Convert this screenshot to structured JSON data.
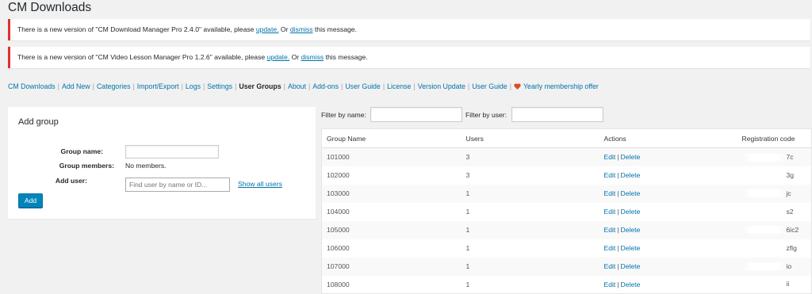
{
  "page": {
    "title": "CM Downloads"
  },
  "notices": [
    {
      "prefix": "There is a new version of \"CM Download Manager Pro 2.4.0\" available, please ",
      "update_link": "update.",
      "middle": " Or ",
      "dismiss_link": "dismiss",
      "suffix": " this message."
    },
    {
      "prefix": "There is a new version of \"CM Video Lesson Manager Pro 1.2.6\" available, please ",
      "update_link": "update.",
      "middle": " Or ",
      "dismiss_link": "dismiss",
      "suffix": " this message."
    }
  ],
  "subnav": {
    "items": [
      "CM Downloads",
      "Add New",
      "Categories",
      "Import/Export",
      "Logs",
      "Settings",
      "User Groups",
      "About",
      "Add-ons",
      "User Guide",
      "License",
      "Version Update",
      "User Guide",
      "Yearly membership offer"
    ],
    "separator": "|",
    "current": "User Groups",
    "heart_color": "#d54e21"
  },
  "add_group": {
    "title": "Add group",
    "group_name_label": "Group name:",
    "group_members_label": "Group members:",
    "group_members_value": "No members.",
    "add_user_label": "Add user:",
    "add_user_placeholder": "Find user by name or ID...",
    "show_all_users": "Show all users",
    "add_button": "Add"
  },
  "filters": {
    "by_name_label": "Filter by name:",
    "by_user_label": "Filter by user:"
  },
  "table": {
    "headers": [
      "Group Name",
      "Users",
      "Actions",
      "Registration code"
    ],
    "edit_label": "Edit",
    "delete_label": "Delete",
    "action_separator": "|",
    "rows": [
      {
        "name": "101000",
        "users": "3",
        "code": "7c"
      },
      {
        "name": "102000",
        "users": "3",
        "code": "3g"
      },
      {
        "name": "103000",
        "users": "1",
        "code": "jc"
      },
      {
        "name": "104000",
        "users": "1",
        "code": "s2"
      },
      {
        "name": "105000",
        "users": "1",
        "code": "6ic2"
      },
      {
        "name": "106000",
        "users": "1",
        "code": "zflg"
      },
      {
        "name": "107000",
        "users": "1",
        "code": "io"
      },
      {
        "name": "108000",
        "users": "1",
        "code": "ii"
      }
    ]
  },
  "colors": {
    "notice_border": "#dc3232",
    "link": "#0073aa",
    "primary_button": "#0085ba"
  }
}
